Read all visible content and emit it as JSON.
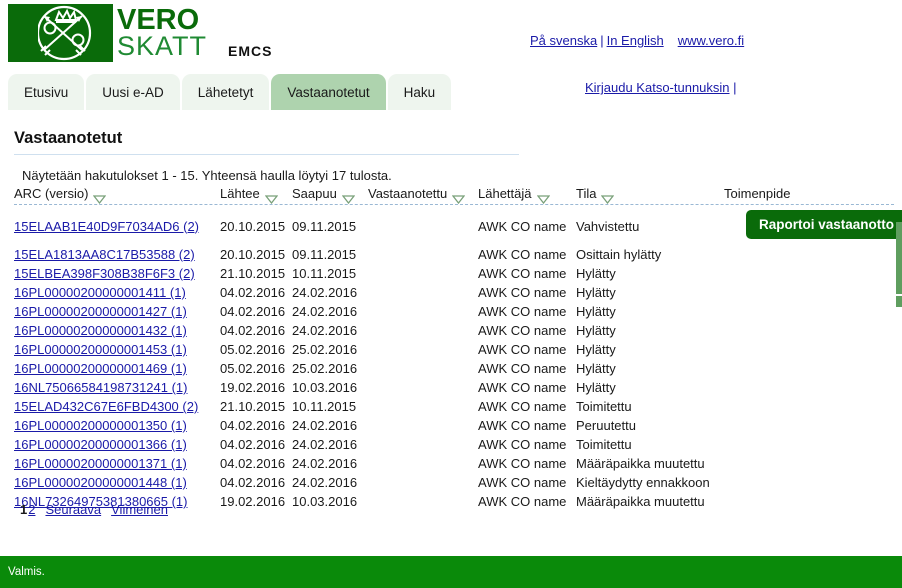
{
  "brand": {
    "name_top": "VERO",
    "name_bottom": "SKATT",
    "crest_icon": "finnish-tax-crest-icon",
    "app_title": "EMCS",
    "green": "#0a6b0a",
    "light_green": "#1f8a33"
  },
  "top_links": {
    "swedish": "På svenska",
    "separator": "|",
    "english": "In English",
    "website": "www.vero.fi",
    "login": "Kirjaudu Katso-tunnuksin",
    "login_separator": "|"
  },
  "tabs": [
    {
      "label": "Etusivu",
      "active": false
    },
    {
      "label": "Uusi e-AD",
      "active": false
    },
    {
      "label": "Lähetetyt",
      "active": false
    },
    {
      "label": "Vastaanotetut",
      "active": true
    },
    {
      "label": "Haku",
      "active": false
    }
  ],
  "page": {
    "title": "Vastaanotetut",
    "result_note": "Näytetään hakutulokset 1 - 15. Yhteensä haulla löytyi 17 tulosta."
  },
  "table": {
    "columns": [
      {
        "label": "ARC (versio)",
        "sortable": true
      },
      {
        "label": "Lähtee",
        "sortable": true
      },
      {
        "label": "Saapuu",
        "sortable": true
      },
      {
        "label": "Vastaanotettu",
        "sortable": true
      },
      {
        "label": "Lähettäjä",
        "sortable": true
      },
      {
        "label": "Tila",
        "sortable": true
      },
      {
        "label": "Toimenpide",
        "sortable": false
      }
    ],
    "rows": [
      {
        "arc": "15ELAAB1E40D9F7034AD6 (2)",
        "leaves": "20.10.2015",
        "arrives": "09.11.2015",
        "received": "",
        "sender": "AWK CO name",
        "state": "Vahvistettu",
        "action": "Raportoi vastaanotto"
      },
      {
        "arc": "15ELA1813AA8C17B53588 (2)",
        "leaves": "20.10.2015",
        "arrives": "09.11.2015",
        "received": "",
        "sender": "AWK CO name",
        "state": "Osittain hylätty",
        "action": ""
      },
      {
        "arc": "15ELBEA398F308B38F6F3 (2)",
        "leaves": "21.10.2015",
        "arrives": "10.11.2015",
        "received": "",
        "sender": "AWK CO name",
        "state": "Hylätty",
        "action": ""
      },
      {
        "arc": "16PL00000200000001411 (1)",
        "leaves": "04.02.2016",
        "arrives": "24.02.2016",
        "received": "",
        "sender": "AWK CO name",
        "state": "Hylätty",
        "action": ""
      },
      {
        "arc": "16PL00000200000001427 (1)",
        "leaves": "04.02.2016",
        "arrives": "24.02.2016",
        "received": "",
        "sender": "AWK CO name",
        "state": "Hylätty",
        "action": ""
      },
      {
        "arc": "16PL00000200000001432 (1)",
        "leaves": "04.02.2016",
        "arrives": "24.02.2016",
        "received": "",
        "sender": "AWK CO name",
        "state": "Hylätty",
        "action": ""
      },
      {
        "arc": "16PL00000200000001453 (1)",
        "leaves": "05.02.2016",
        "arrives": "25.02.2016",
        "received": "",
        "sender": "AWK CO name",
        "state": "Hylätty",
        "action": ""
      },
      {
        "arc": "16PL00000200000001469 (1)",
        "leaves": "05.02.2016",
        "arrives": "25.02.2016",
        "received": "",
        "sender": "AWK CO name",
        "state": "Hylätty",
        "action": ""
      },
      {
        "arc": "16NL75066584198731241 (1)",
        "leaves": "19.02.2016",
        "arrives": "10.03.2016",
        "received": "",
        "sender": "AWK CO name",
        "state": "Hylätty",
        "action": ""
      },
      {
        "arc": "15ELAD432C67E6FBD4300 (2)",
        "leaves": "21.10.2015",
        "arrives": "10.11.2015",
        "received": "",
        "sender": "AWK CO name",
        "state": "Toimitettu",
        "action": ""
      },
      {
        "arc": "16PL00000200000001350 (1)",
        "leaves": "04.02.2016",
        "arrives": "24.02.2016",
        "received": "",
        "sender": "AWK CO name",
        "state": "Peruutettu",
        "action": ""
      },
      {
        "arc": "16PL00000200000001366 (1)",
        "leaves": "04.02.2016",
        "arrives": "24.02.2016",
        "received": "",
        "sender": "AWK CO name",
        "state": "Toimitettu",
        "action": ""
      },
      {
        "arc": "16PL00000200000001371 (1)",
        "leaves": "04.02.2016",
        "arrives": "24.02.2016",
        "received": "",
        "sender": "AWK CO name",
        "state": "Määräpaikka muutettu",
        "action": ""
      },
      {
        "arc": "16PL00000200000001448 (1)",
        "leaves": "04.02.2016",
        "arrives": "24.02.2016",
        "received": "",
        "sender": "AWK CO name",
        "state": "Kieltäydytty ennakkoon",
        "action": ""
      },
      {
        "arc": "16NL73264975381380665 (1)",
        "leaves": "19.02.2016",
        "arrives": "10.03.2016",
        "received": "",
        "sender": "AWK CO name",
        "state": "Määräpaikka muutettu",
        "action": ""
      }
    ]
  },
  "pager": {
    "current_page": "1",
    "page_2": "2",
    "next": "Seuraava",
    "last": "Viimeinen"
  },
  "status_bar": {
    "text": "Valmis.",
    "background": "#0a8a0a"
  }
}
